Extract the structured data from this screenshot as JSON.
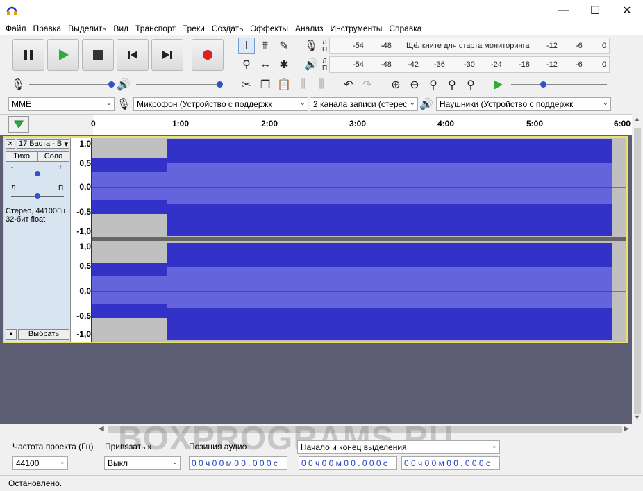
{
  "window": {
    "minimize": "—",
    "maximize": "☐",
    "close": "✕"
  },
  "menu": [
    "Файл",
    "Правка",
    "Выделить",
    "Вид",
    "Транспорт",
    "Треки",
    "Создать",
    "Эффекты",
    "Анализ",
    "Инструменты",
    "Справка"
  ],
  "meters": {
    "rec_label": "Л\nП",
    "rec_scale": [
      "-54",
      "-48",
      "Щёлкните для старта мониторинга",
      "-12",
      "-6",
      "0"
    ],
    "play_scale": [
      "-54",
      "-48",
      "-42",
      "-36",
      "-30",
      "-24",
      "-18",
      "-12",
      "-6",
      "0"
    ]
  },
  "devices": {
    "host": "MME",
    "mic": "Микрофон (Устройство с поддержк",
    "channels": "2 канала записи (стерес",
    "output": "Наушники (Устройство с поддержк"
  },
  "ruler": [
    "0",
    "1:00",
    "2:00",
    "3:00",
    "4:00",
    "5:00",
    "6:00"
  ],
  "track": {
    "name": "17 Баста - В",
    "mute": "Тихо",
    "solo": "Соло",
    "gain_minus": "-",
    "gain_plus": "+",
    "pan_l": "Л",
    "pan_r": "П",
    "info1": "Стерео, 44100Гц",
    "info2": "32-бит float",
    "select": "Выбрать"
  },
  "amp_labels": [
    "1,0",
    "0,5",
    "0,0",
    "-0,5",
    "-1,0"
  ],
  "bottom": {
    "rate_label": "Частота проекта (Гц)",
    "rate_value": "44100",
    "snap_label": "Привязать к",
    "snap_value": "Выкл",
    "pos_label": "Позиция аудио",
    "pos_value": "0 0 ч 0 0 м 0 0 . 0 0 0 с",
    "sel_label": "Начало и конец выделения",
    "sel_start": "0 0 ч 0 0 м 0 0 . 0 0 0 с",
    "sel_end": "0 0 ч 0 0 м 0 0 . 0 0 0 с"
  },
  "status": "Остановлено.",
  "watermark": "BOXPROGRAMS.RU"
}
